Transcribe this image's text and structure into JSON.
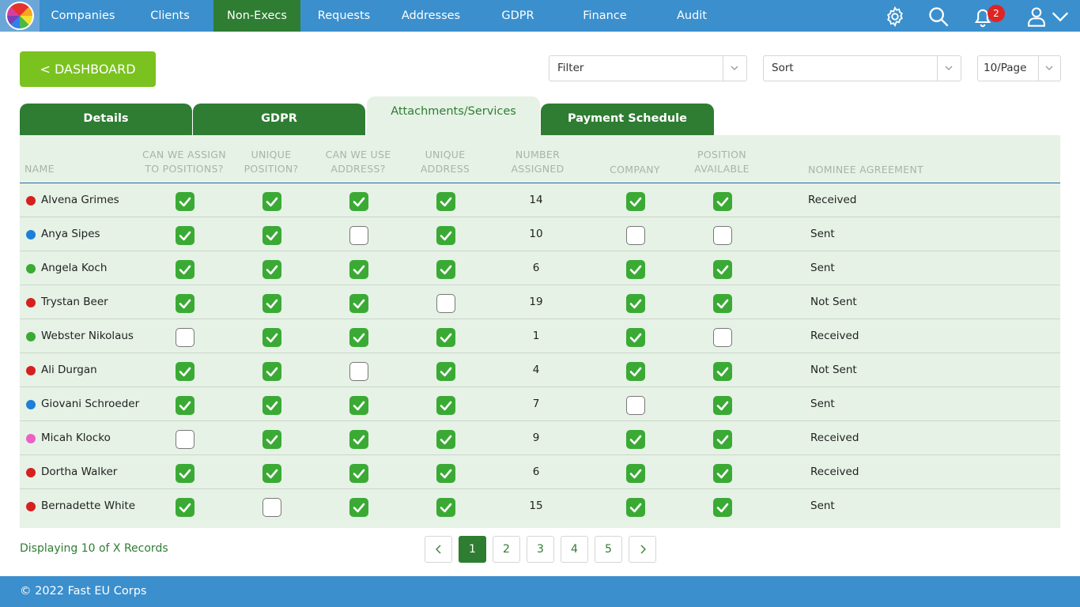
{
  "nav": {
    "items": [
      {
        "label": "Companies"
      },
      {
        "label": "Clients"
      },
      {
        "label": "Non-Execs"
      },
      {
        "label": "Requests"
      },
      {
        "label": "Addresses"
      },
      {
        "label": "GDPR"
      },
      {
        "label": "Finance"
      },
      {
        "label": "Audit"
      }
    ],
    "active_item": "Non-Execs",
    "notification_count": "2",
    "icons": [
      "settings-gear-icon",
      "search-icon",
      "bell-icon",
      "user-icon",
      "chevron-down-icon"
    ]
  },
  "toolbar": {
    "dashboard_label": "< DASHBOARD",
    "filter_label": "Filter",
    "sort_label": "Sort",
    "page_size_label": "10/Page"
  },
  "tabs": [
    {
      "label": "Details"
    },
    {
      "label": "GDPR"
    },
    {
      "label": "Attachments/Services"
    },
    {
      "label": "Payment Schedule"
    }
  ],
  "active_tab": "Attachments/Services",
  "table": {
    "headers": {
      "name": "NAME",
      "assign_l1": "CAN WE ASSIGN",
      "assign_l2": "TO POSITIONS?",
      "unique_pos_l1": "UNIQUE",
      "unique_pos_l2": "POSITION?",
      "use_addr_l1": "CAN WE USE",
      "use_addr_l2": "ADDRESS?",
      "unique_addr_l1": "UNIQUE",
      "unique_addr_l2": "ADDRESS",
      "number_l1": "NUMBER",
      "number_l2": "ASSIGNED",
      "company": "COMPANY",
      "pos_avail_l1": "POSITION",
      "pos_avail_l2": "AVAILABLE",
      "agreement": "NOMINEE AGREEMENT"
    },
    "rows": [
      {
        "name": "Alvena Grimes",
        "status_color": "#d62020",
        "assign": true,
        "unique_position": true,
        "use_address": true,
        "unique_address": true,
        "number_assigned": "14",
        "company": true,
        "position_available": true,
        "agreement": "Received"
      },
      {
        "name": "Anya Sipes",
        "status_color": "#1e7fd6",
        "assign": true,
        "unique_position": true,
        "use_address": false,
        "unique_address": true,
        "number_assigned": "10",
        "company": false,
        "position_available": false,
        "agreement": "Sent"
      },
      {
        "name": "Angela Koch",
        "status_color": "#3aaa35",
        "assign": true,
        "unique_position": true,
        "use_address": true,
        "unique_address": true,
        "number_assigned": "6",
        "company": true,
        "position_available": true,
        "agreement": "Sent"
      },
      {
        "name": "Trystan Beer",
        "status_color": "#d62020",
        "assign": true,
        "unique_position": true,
        "use_address": true,
        "unique_address": false,
        "number_assigned": "19",
        "company": true,
        "position_available": true,
        "agreement": "Not Sent"
      },
      {
        "name": "Webster Nikolaus",
        "status_color": "#3aaa35",
        "assign": false,
        "unique_position": true,
        "use_address": true,
        "unique_address": true,
        "number_assigned": "1",
        "company": true,
        "position_available": false,
        "agreement": "Received"
      },
      {
        "name": "Ali Durgan",
        "status_color": "#d62020",
        "assign": true,
        "unique_position": true,
        "use_address": false,
        "unique_address": true,
        "number_assigned": "4",
        "company": true,
        "position_available": true,
        "agreement": "Not Sent"
      },
      {
        "name": "Giovani Schroeder",
        "status_color": "#1e7fd6",
        "assign": true,
        "unique_position": true,
        "use_address": true,
        "unique_address": true,
        "number_assigned": "7",
        "company": false,
        "position_available": true,
        "agreement": "Sent"
      },
      {
        "name": "Micah Klocko",
        "status_color": "#ee5fc4",
        "assign": false,
        "unique_position": true,
        "use_address": true,
        "unique_address": true,
        "number_assigned": "9",
        "company": true,
        "position_available": true,
        "agreement": "Received"
      },
      {
        "name": "Dortha Walker",
        "status_color": "#d62020",
        "assign": true,
        "unique_position": true,
        "use_address": true,
        "unique_address": true,
        "number_assigned": "6",
        "company": true,
        "position_available": true,
        "agreement": "Received"
      },
      {
        "name": "Bernadette White",
        "status_color": "#d62020",
        "assign": true,
        "unique_position": false,
        "use_address": true,
        "unique_address": true,
        "number_assigned": "15",
        "company": true,
        "position_available": true,
        "agreement": "Sent"
      }
    ]
  },
  "pagination": {
    "records_text": "Displaying 10 of X Records",
    "pages": [
      "1",
      "2",
      "3",
      "4",
      "5"
    ],
    "current_page": "1"
  },
  "footer": {
    "text": "© 2022 Fast EU Corps"
  }
}
